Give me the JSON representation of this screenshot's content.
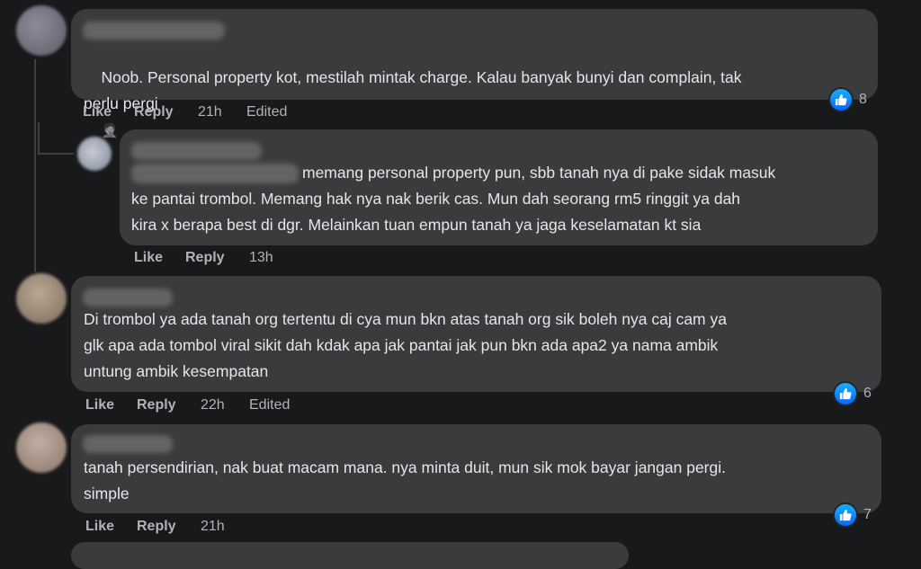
{
  "comments": [
    {
      "text": "Noob. Personal property kot, mestilah mintak charge. Kalau banyak bunyi dan complain, tak\nperlu pergi",
      "emoji": "🤦",
      "actions": {
        "like": "Like",
        "reply": "Reply",
        "time": "21h",
        "edited": "Edited"
      },
      "reaction_count": "8"
    },
    {
      "text": "memang personal property pun, sbb tanah nya di pake sidak masuk\nke pantai trombol. Memang hak nya nak berik cas. Mun dah seorang rm5 ringgit ya dah\nkira x berapa best di dgr. Melainkan tuan empun tanah ya jaga keselamatan kt sia",
      "actions": {
        "like": "Like",
        "reply": "Reply",
        "time": "13h"
      }
    },
    {
      "text": "Di trombol ya ada tanah org tertentu di cya mun bkn atas tanah org sik boleh nya caj cam ya\nglk apa ada tombol viral sikit dah kdak apa jak pantai jak pun bkn ada apa2 ya nama ambik\nuntung ambik kesempatan",
      "actions": {
        "like": "Like",
        "reply": "Reply",
        "time": "22h",
        "edited": "Edited"
      },
      "reaction_count": "6"
    },
    {
      "text": "tanah persendirian, nak buat macam mana. nya minta duit, mun sik mok bayar jangan pergi.\nsimple",
      "actions": {
        "like": "Like",
        "reply": "Reply",
        "time": "21h"
      },
      "reaction_count": "7"
    }
  ],
  "colors": {
    "background": "#18191a",
    "bubble": "#3a3b3c",
    "text": "#e4e6eb",
    "secondary_text": "#b0b3b8",
    "like_blue": "#0866ff"
  },
  "icons": {
    "reaction": "like-thumbs-up-icon"
  }
}
